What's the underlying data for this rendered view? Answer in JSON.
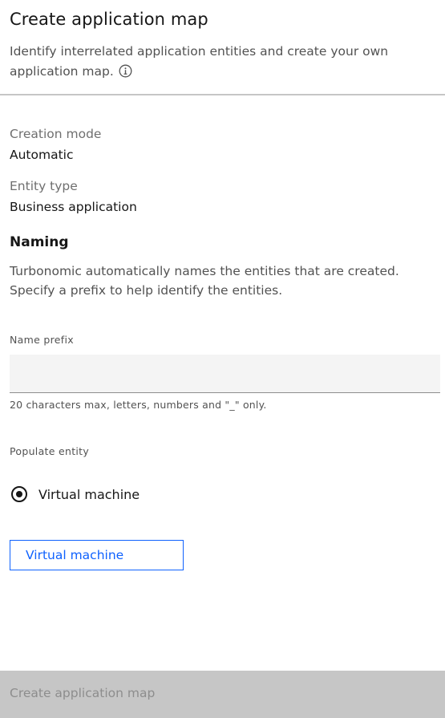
{
  "header": {
    "title": "Create application map",
    "description": "Identify interrelated application entities and create your own application map.",
    "info_icon": "information-icon"
  },
  "details": {
    "creation_mode_label": "Creation mode",
    "creation_mode_value": "Automatic",
    "entity_type_label": "Entity type",
    "entity_type_value": "Business application"
  },
  "naming": {
    "heading": "Naming",
    "description": "Turbonomic automatically names the entities that are created. Specify a prefix to help identify the entities.",
    "name_prefix_label": "Name prefix",
    "name_prefix_value": "",
    "name_prefix_placeholder": "",
    "helper_text": "20 characters max, letters, numbers and \"_\" only."
  },
  "populate": {
    "label": "Populate entity",
    "radio_option": "Virtual machine",
    "radio_selected": true,
    "button_label": "Virtual machine"
  },
  "footer": {
    "primary_button": "Create application map",
    "disabled": true
  },
  "colors": {
    "accent": "#0f62fe",
    "divider": "#c6c6c6",
    "disabled_bg": "#c6c6c6",
    "disabled_text": "#8d8d8d"
  }
}
